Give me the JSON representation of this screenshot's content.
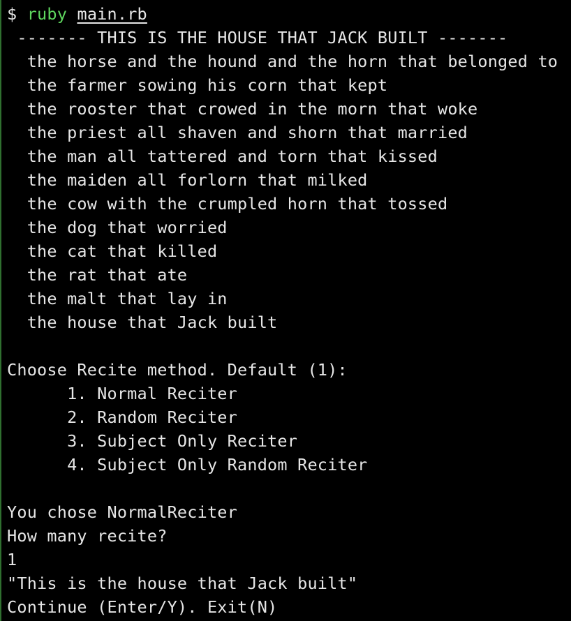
{
  "prompt": {
    "symbol": "$ ",
    "command": "ruby",
    "argument": "main.rb"
  },
  "output": {
    "title_line": " ------- THIS IS THE HOUSE THAT JACK BUILT -------",
    "verse_lines": [
      "  the horse and the hound and the horn that belonged to",
      "  the farmer sowing his corn that kept",
      "  the rooster that crowed in the morn that woke",
      "  the priest all shaven and shorn that married",
      "  the man all tattered and torn that kissed",
      "  the maiden all forlorn that milked",
      "  the cow with the crumpled horn that tossed",
      "  the dog that worried",
      "  the cat that killed",
      "  the rat that ate",
      "  the malt that lay in",
      "  the house that Jack built"
    ],
    "menu_prompt": "Choose Recite method. Default (1):",
    "menu_options": [
      "      1. Normal Reciter",
      "      2. Random Reciter",
      "      3. Subject Only Reciter",
      "      4. Subject Only Random Reciter"
    ],
    "chosen": "You chose NormalReciter",
    "count_prompt": "How many recite?",
    "count_input": "1",
    "result": "\"This is the house that Jack built\"",
    "continue_prompt": "Continue (Enter/Y). Exit(N)"
  }
}
